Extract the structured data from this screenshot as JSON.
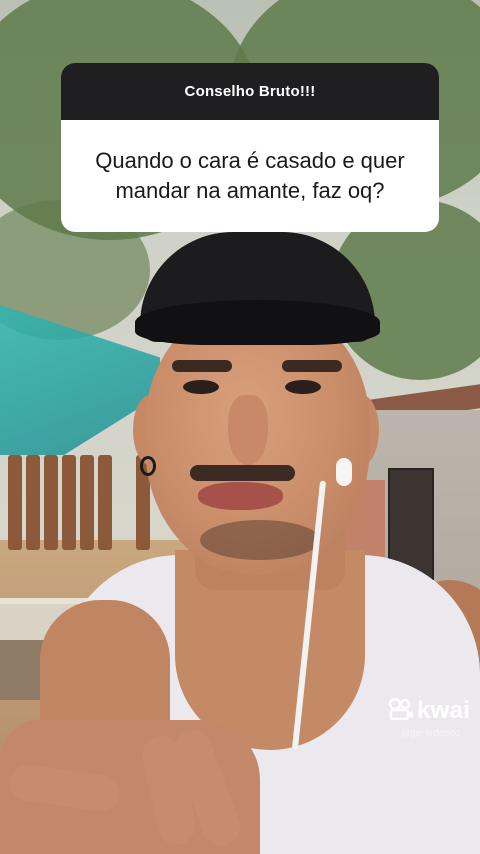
{
  "question_card": {
    "header": "Conselho Bruto!!!",
    "question": "Quando o cara é casado e quer mandar na amante, faz oq?"
  },
  "watermark": {
    "logo_icon": "kwai-logo-icon",
    "brand": "kwai",
    "handle": "@gerardosco"
  },
  "colors": {
    "card_header_bg": "#1f1f21",
    "card_body_bg": "#ffffff"
  }
}
